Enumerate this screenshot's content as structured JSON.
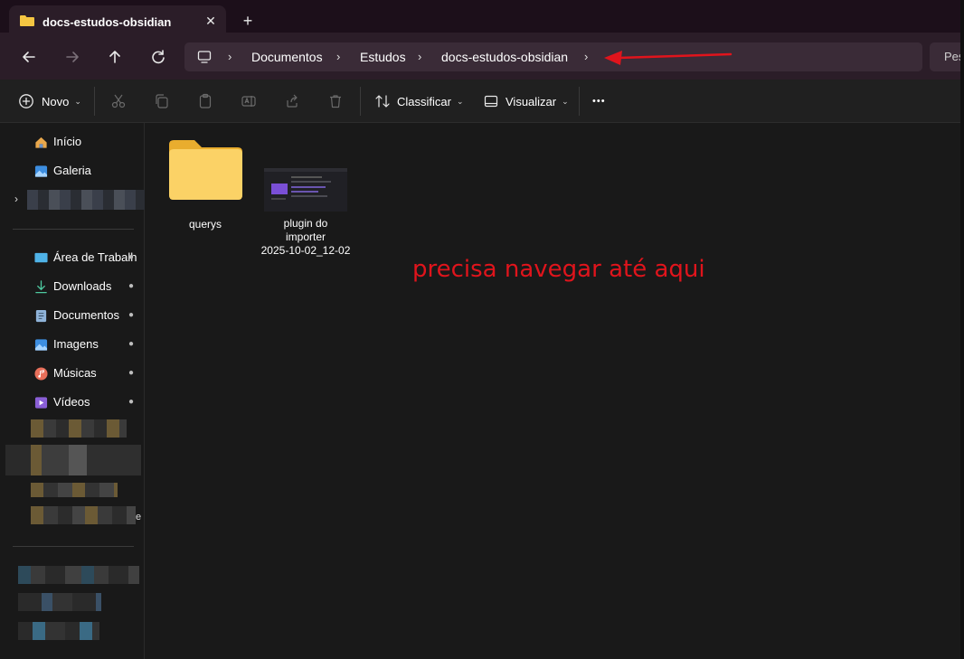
{
  "window": {
    "tab_title": "docs-estudos-obsidian",
    "close_glyph": "✕",
    "new_tab_glyph": "+"
  },
  "address_bar": {
    "crumbs": [
      "Documentos",
      "Estudos",
      "docs-estudos-obsidian"
    ],
    "separator": "›",
    "search_placeholder": "Pes"
  },
  "toolbar": {
    "new_label": "Novo",
    "sort_label": "Classificar",
    "view_label": "Visualizar",
    "more_label": "•••",
    "chevron": "⌄"
  },
  "sidebar": {
    "top_items": [
      {
        "label": "Início",
        "icon": "home-icon"
      },
      {
        "label": "Galeria",
        "icon": "gallery-icon"
      }
    ],
    "pinned_items": [
      {
        "label": "Área de Trabalh",
        "icon": "desktop-icon"
      },
      {
        "label": "Downloads",
        "icon": "download-icon"
      },
      {
        "label": "Documentos",
        "icon": "documents-icon"
      },
      {
        "label": "Imagens",
        "icon": "pictures-icon"
      },
      {
        "label": "Músicas",
        "icon": "music-icon"
      },
      {
        "label": "Vídeos",
        "icon": "videos-icon"
      }
    ],
    "pin_glyph": "📌",
    "expander_glyph": "›",
    "trailing_glyph": "e"
  },
  "files": [
    {
      "name": "querys",
      "type": "folder"
    },
    {
      "name_lines": [
        "plugin do",
        "importer",
        "2025-10-02_12-02"
      ],
      "type": "image"
    }
  ],
  "annotation": {
    "text": "precisa navegar até aqui",
    "color": "#e0141c"
  },
  "colors": {
    "title_bg": "#1c0f1a",
    "nav_bg": "#2b1d28",
    "content_bg": "#191919",
    "folder_yellow": "#f4c542"
  }
}
